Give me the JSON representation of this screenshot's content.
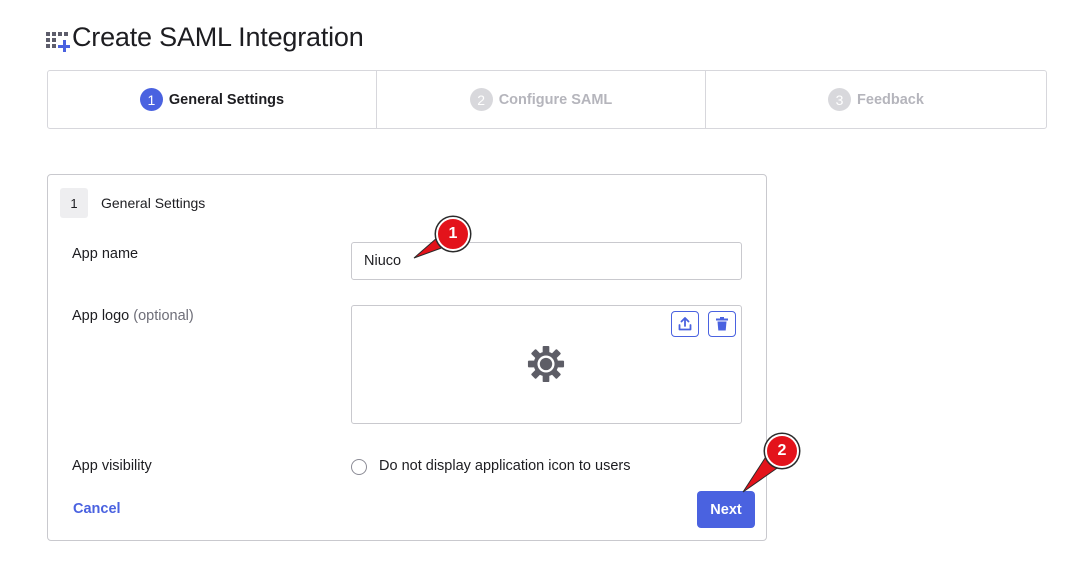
{
  "header": {
    "title": "Create SAML Integration",
    "icon": "grid-plus-icon"
  },
  "stepper": {
    "steps": [
      {
        "number": "1",
        "label": "General Settings",
        "state": "active"
      },
      {
        "number": "2",
        "label": "Configure SAML",
        "state": "inactive"
      },
      {
        "number": "3",
        "label": "Feedback",
        "state": "inactive"
      }
    ]
  },
  "card": {
    "section_number": "1",
    "section_title": "General Settings",
    "app_name": {
      "label": "App name",
      "value": "Niuco"
    },
    "app_logo": {
      "label": "App logo",
      "optional": "(optional)",
      "upload_icon": "upload-icon",
      "delete_icon": "trash-icon",
      "placeholder_icon": "gear-icon"
    },
    "app_visibility": {
      "label": "App visibility",
      "checkbox_label": "Do not display application icon to users",
      "checked": false
    },
    "actions": {
      "cancel_label": "Cancel",
      "next_label": "Next"
    }
  },
  "annotations": [
    {
      "number": "1"
    },
    {
      "number": "2"
    }
  ],
  "colors": {
    "accent": "#4a62e0",
    "annotation": "#e3131b",
    "border": "#c9c9ce"
  }
}
